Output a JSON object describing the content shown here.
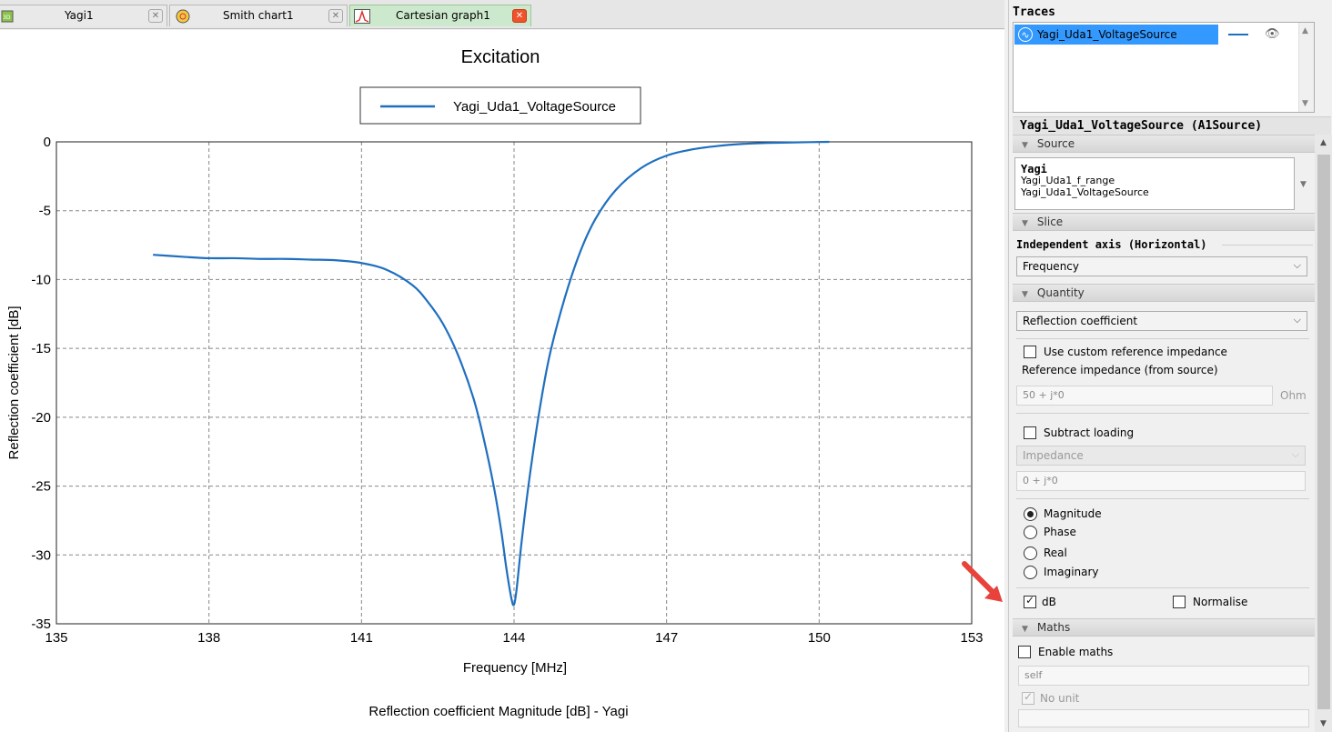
{
  "tabs": [
    {
      "label": "Yagi1",
      "active": false
    },
    {
      "label": "Smith chart1",
      "active": false
    },
    {
      "label": "Cartesian graph1",
      "active": true
    }
  ],
  "chart_data": {
    "type": "line",
    "title": "Excitation",
    "subtitle": "Reflection coefficient Magnitude [dB] - Yagi",
    "xlabel": "Frequency [MHz]",
    "ylabel": "Reflection coefficient [dB]",
    "xlim": [
      135,
      153
    ],
    "ylim": [
      -35,
      0
    ],
    "xticks": [
      135,
      138,
      141,
      144,
      147,
      150,
      153
    ],
    "yticks": [
      0,
      -5,
      -10,
      -15,
      -20,
      -25,
      -30,
      -35
    ],
    "grid": true,
    "legend_position": "top-center",
    "series": [
      {
        "name": "Yagi_Uda1_VoltageSource",
        "color": "#1f6fbf",
        "x": [
          136.9,
          137.5,
          138.0,
          138.5,
          139.0,
          139.5,
          140.0,
          140.5,
          141.0,
          141.5,
          142.0,
          142.3,
          142.6,
          142.9,
          143.2,
          143.4,
          143.6,
          143.75,
          143.85,
          143.95,
          144.0,
          144.05,
          144.15,
          144.3,
          144.5,
          144.7,
          145.0,
          145.3,
          145.6,
          146.0,
          146.5,
          147.0,
          147.5,
          148.0,
          148.5,
          149.0,
          149.5,
          150.2
        ],
        "y": [
          -8.2,
          -8.35,
          -8.45,
          -8.45,
          -8.5,
          -8.5,
          -8.55,
          -8.6,
          -8.8,
          -9.3,
          -10.4,
          -11.6,
          -13.2,
          -15.5,
          -18.6,
          -21.5,
          -25.0,
          -28.3,
          -31.0,
          -33.2,
          -33.6,
          -32.5,
          -29.0,
          -24.5,
          -19.5,
          -15.5,
          -11.3,
          -8.0,
          -5.6,
          -3.5,
          -1.9,
          -1.0,
          -0.55,
          -0.3,
          -0.15,
          -0.08,
          -0.04,
          0.0
        ]
      }
    ]
  },
  "traces": {
    "header": "Traces",
    "item_label": "Yagi_Uda1_VoltageSource"
  },
  "props": {
    "title": "Yagi_Uda1_VoltageSource (A1Source)",
    "source_section": "Source",
    "source_lines": [
      "Yagi",
      "Yagi_Uda1_f_range",
      "Yagi_Uda1_VoltageSource"
    ],
    "slice_section": "Slice",
    "independent_axis_label": "Independent axis (Horizontal)",
    "independent_axis_value": "Frequency",
    "quantity_section": "Quantity",
    "quantity_value": "Reflection coefficient",
    "custom_ref_label": "Use custom reference impedance",
    "ref_impedance_label": "Reference impedance (from source)",
    "ref_impedance_value": "50 + j*0",
    "ref_impedance_unit": "Ohm",
    "subtract_loading_label": "Subtract loading",
    "loading_select": "Impedance",
    "loading_value": "0 + j*0",
    "radio_options": [
      "Magnitude",
      "Phase",
      "Real",
      "Imaginary"
    ],
    "radio_selected": "Magnitude",
    "db_label": "dB",
    "normalise_label": "Normalise",
    "maths_section": "Maths",
    "enable_maths_label": "Enable maths",
    "maths_expr": "self",
    "no_unit_label": "No unit"
  },
  "colors": {
    "accent": "#3399ff",
    "trace": "#1f6fbf",
    "annotation_arrow": "#e8423a"
  }
}
